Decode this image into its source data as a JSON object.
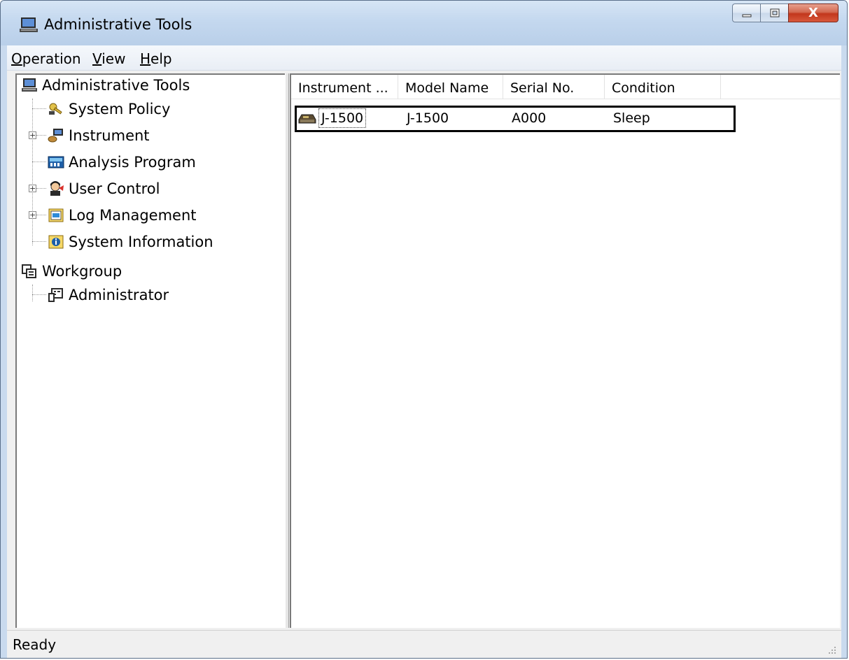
{
  "window": {
    "title": "Administrative Tools",
    "buttons": {
      "close": "X"
    }
  },
  "menu": [
    {
      "label_acc": "O",
      "label_rest": "peration"
    },
    {
      "label_acc": "V",
      "label_rest": "iew"
    },
    {
      "label_acc": "H",
      "label_rest": "elp"
    }
  ],
  "tree": {
    "root": {
      "label": "Administrative Tools",
      "icon": "computer-icon"
    },
    "children": [
      {
        "label": "System Policy",
        "icon": "key-icon"
      },
      {
        "label": "Instrument",
        "icon": "instrument-icon"
      },
      {
        "label": "Analysis Program",
        "icon": "program-icon"
      },
      {
        "label": "User Control",
        "icon": "user-icon"
      },
      {
        "label": "Log Management",
        "icon": "log-icon"
      },
      {
        "label": "System Information",
        "icon": "info-icon"
      }
    ],
    "root2": {
      "label": "Workgroup",
      "icon": "workgroup-icon"
    },
    "children2": [
      {
        "label": "Administrator",
        "icon": "admin-icon"
      }
    ]
  },
  "list": {
    "columns": [
      "Instrument ...",
      "Model Name",
      "Serial No.",
      "Condition"
    ],
    "rows": [
      {
        "instrument": "J-1500",
        "model": "J-1500",
        "serial": "A000",
        "condition": "Sleep",
        "icon": "instrument-device-icon"
      }
    ]
  },
  "status": {
    "text": "Ready"
  }
}
